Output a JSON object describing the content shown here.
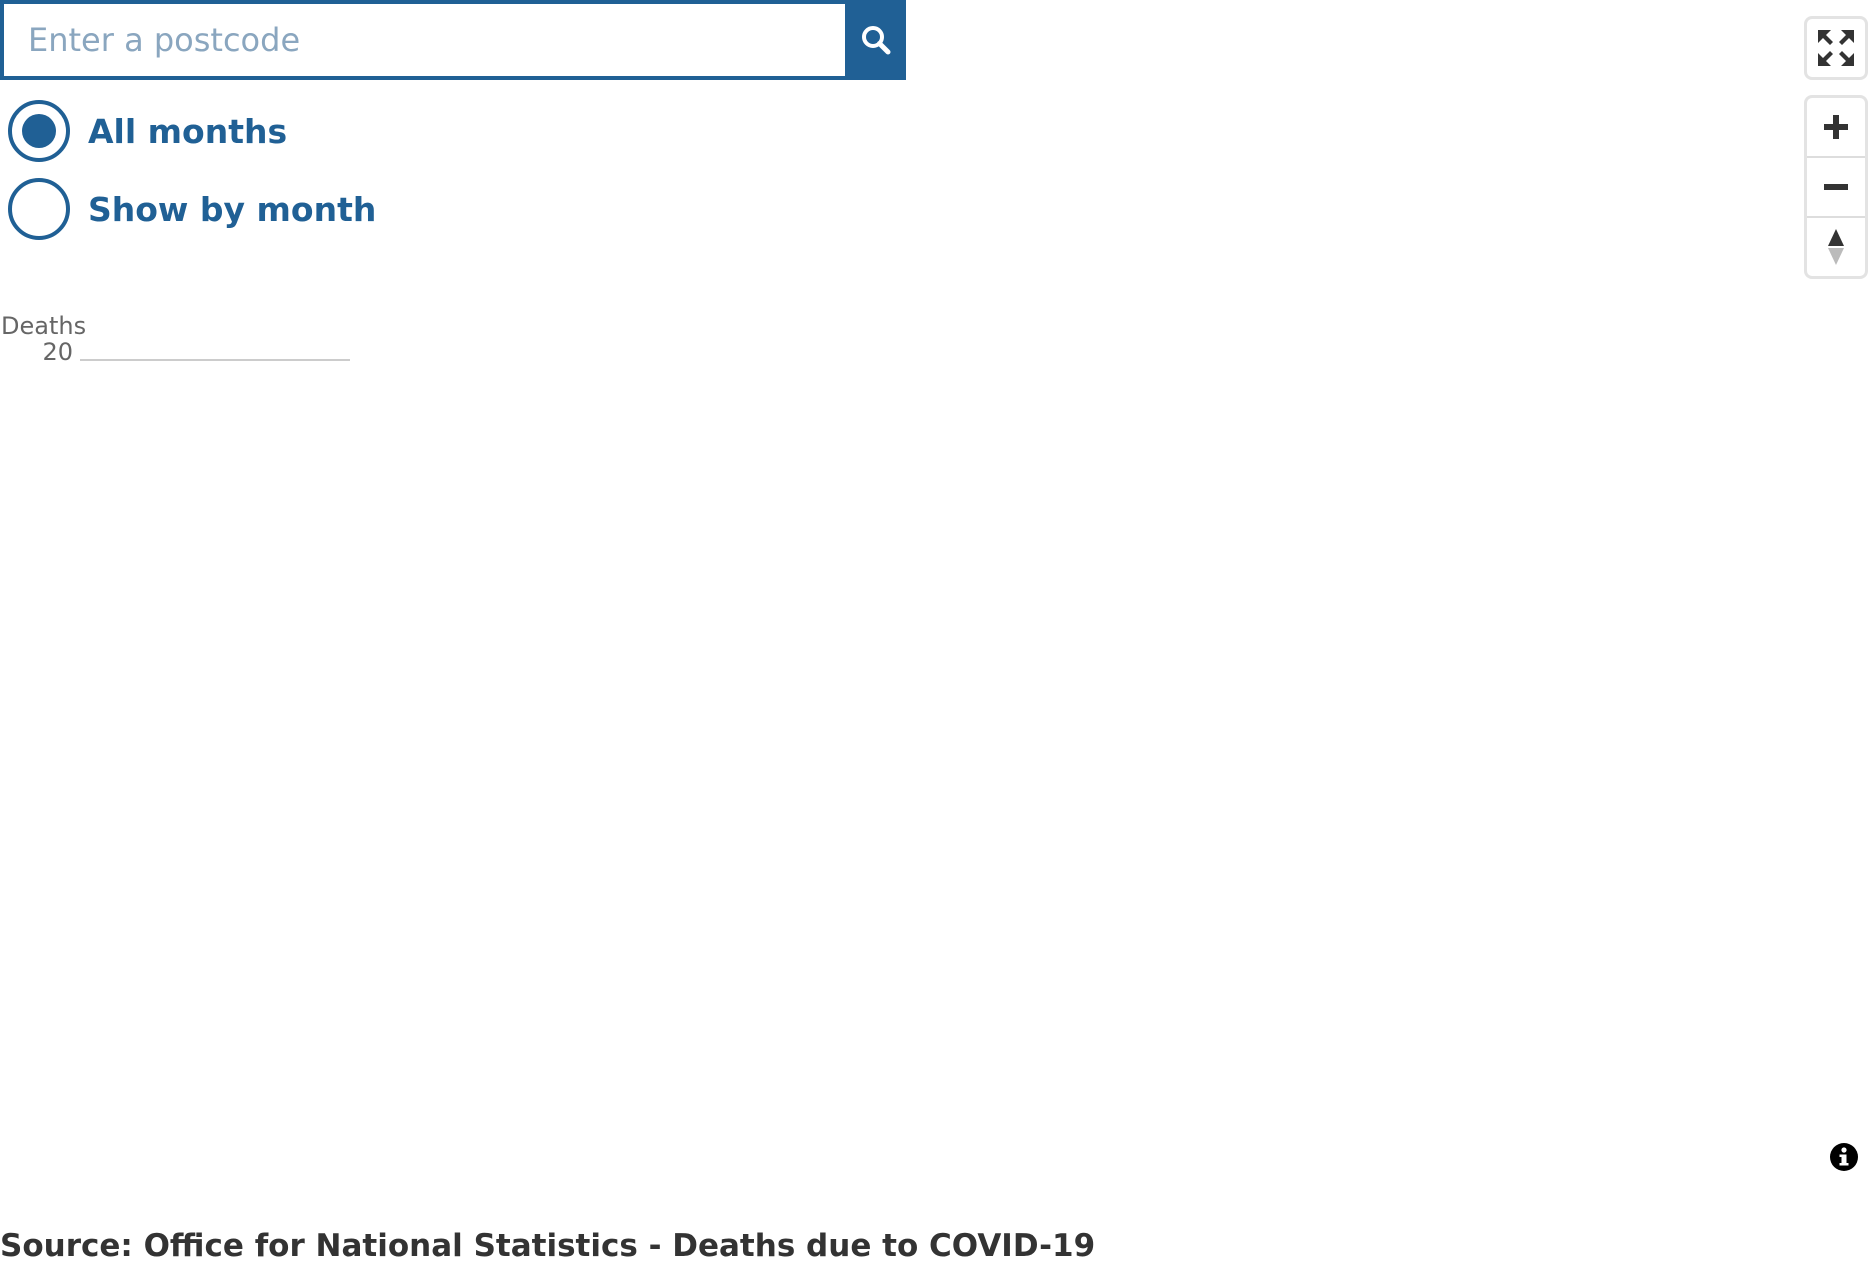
{
  "search": {
    "placeholder": "Enter a postcode",
    "value": ""
  },
  "radios": [
    {
      "label": "All months",
      "selected": true
    },
    {
      "label": "Show by month",
      "selected": false
    }
  ],
  "chart_data": {
    "type": "bar",
    "title": "",
    "xlabel": "",
    "ylabel": "Deaths",
    "y_ticks": [
      "20"
    ],
    "categories": [],
    "values": []
  },
  "footer": {
    "source": "Source: Office for National Statistics - Deaths due to COVID-19"
  },
  "icons": {
    "search": "search-icon",
    "fullscreen": "fullscreen-icon",
    "zoom_in": "plus-icon",
    "zoom_out": "minus-icon",
    "compass": "compass-icon",
    "info": "info-icon"
  },
  "colors": {
    "accent": "#206095",
    "text": "#333333"
  }
}
